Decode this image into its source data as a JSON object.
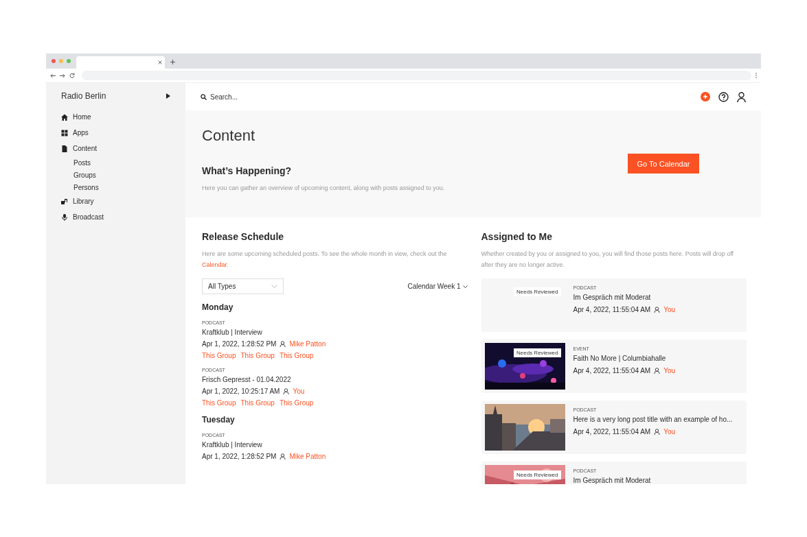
{
  "sidebar": {
    "title": "Radio Berlin",
    "items": [
      {
        "label": "Home"
      },
      {
        "label": "Apps"
      },
      {
        "label": "Content",
        "children": [
          {
            "label": "Posts"
          },
          {
            "label": "Groups"
          },
          {
            "label": "Persons"
          }
        ]
      },
      {
        "label": "Library"
      },
      {
        "label": "Broadcast"
      }
    ]
  },
  "search": {
    "placeholder": "Search..."
  },
  "hero": {
    "title": "Content",
    "heading": "What’s Happening?",
    "description": "Here you can gather an overview of upcoming content, along with posts assigned to you.",
    "button": "Go To Calendar"
  },
  "release_schedule": {
    "title": "Release Schedule",
    "description": "Here are some upcoming scheduled posts. To see the whole month in view, check out the",
    "link": "Calendar",
    "description_end": ".",
    "filter": {
      "value": "All Types"
    },
    "week": "Calendar Week 1",
    "days": [
      {
        "name": "Monday",
        "posts": [
          {
            "type": "PODCAST",
            "title": "Kraftklub | Interview",
            "date": "Apr 1, 2022, 1:28:52 PM",
            "assignee": "Mike Patton",
            "groups": [
              "This Group",
              "This Group",
              "This Group"
            ]
          },
          {
            "type": "PODCAST",
            "title": "Frisch Gepresst - 01.04.2022",
            "date": "Apr 1, 2022, 10:25:17 AM",
            "assignee": "You",
            "groups": [
              "This Group",
              "This Group",
              "This Group"
            ]
          }
        ]
      },
      {
        "name": "Tuesday",
        "posts": [
          {
            "type": "PODCAST",
            "title": "Kraftklub | Interview",
            "date": "Apr 1, 2022, 1:28:52 PM",
            "assignee": "Mike Patton"
          }
        ]
      }
    ]
  },
  "assigned": {
    "title": "Assigned to Me",
    "description": "Whether created by you or assigned to you, you will find those posts here. Posts will drop off after they are no longer active.",
    "posts": [
      {
        "badge": "Needs Reviewed",
        "picture": false,
        "type": "PODCAST",
        "title": "Im Gespräch mit Moderat",
        "date": "Apr 4, 2022, 11:55:04 AM",
        "assignee": "You"
      },
      {
        "badge": "Needs Reviewed",
        "picture": true,
        "type": "EVENT",
        "title": "Faith No More | Columbiahalle",
        "date": "Apr 4, 2022, 11:55:04 AM",
        "assignee": "You"
      },
      {
        "picture": true,
        "type": "PODCAST",
        "title": "Here is a very long post title with an example of ho...",
        "date": "Apr 4, 2022, 11:55:04 AM",
        "assignee": "You"
      },
      {
        "badge": "Needs Reviewed",
        "picture": true,
        "type": "PODCAST",
        "title": "Im Gespräch mit Moderat"
      }
    ]
  }
}
